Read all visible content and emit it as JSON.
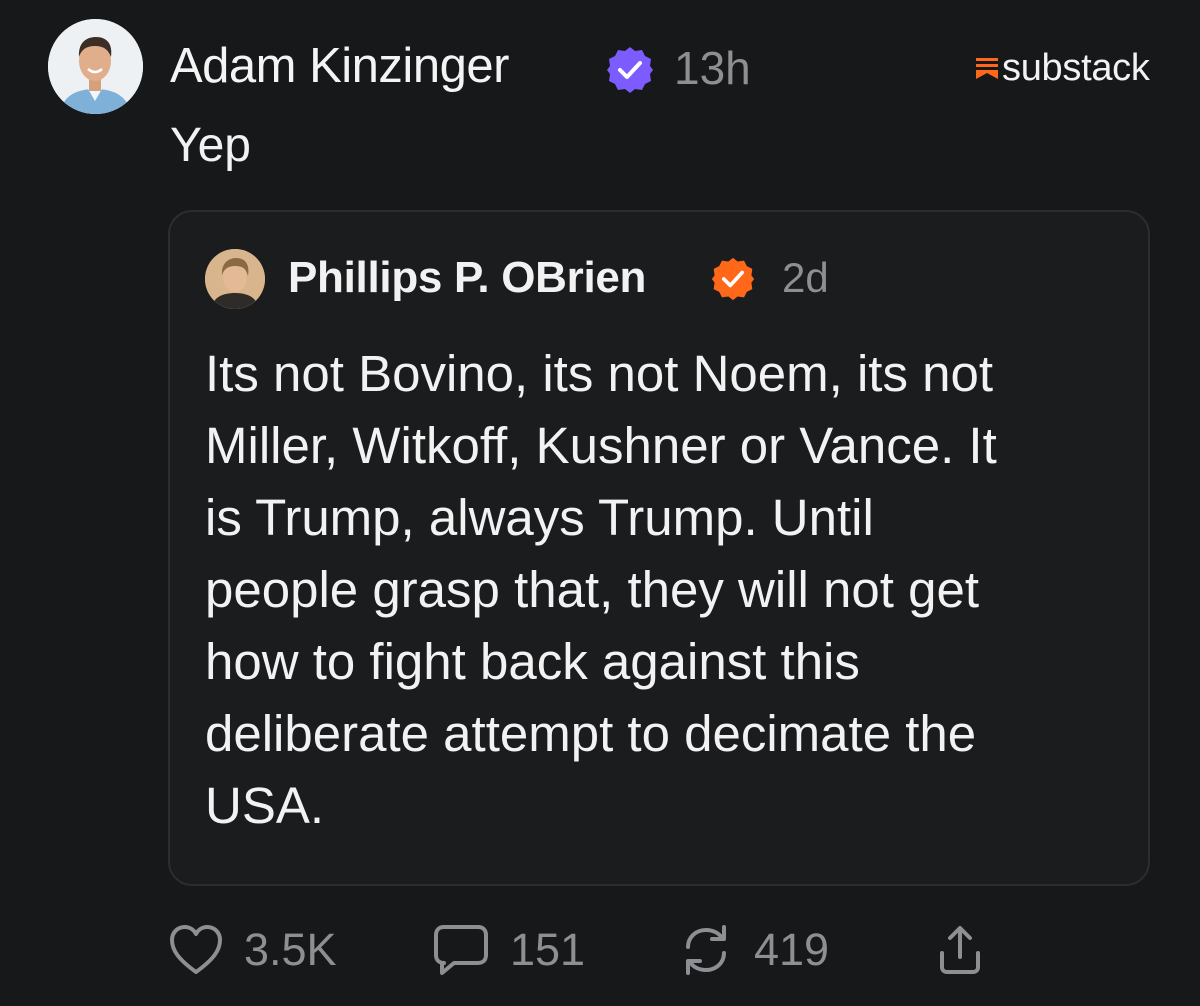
{
  "post": {
    "author_name": "Adam Kinzinger",
    "time": "13h",
    "brand": "substack",
    "body": "Yep",
    "colors": {
      "verified_main": "#7c5cff",
      "verified_quote": "#ff6719",
      "brand_accent": "#ff6719"
    }
  },
  "quote": {
    "author_name": "Phillips P. OBrien",
    "time": "2d",
    "lines": [
      "Its not Bovino, its not Noem, its not",
      "Miller, Witkoff, Kushner or Vance. It",
      "is Trump, always Trump. Until",
      "people grasp that, they will not get",
      "how to fight back against this",
      "deliberate attempt to decimate the",
      "USA."
    ]
  },
  "actions": {
    "likes": "3.5K",
    "comments": "151",
    "restacks": "419",
    "icons": [
      "heart-icon",
      "comment-icon",
      "restack-icon",
      "share-icon"
    ]
  }
}
